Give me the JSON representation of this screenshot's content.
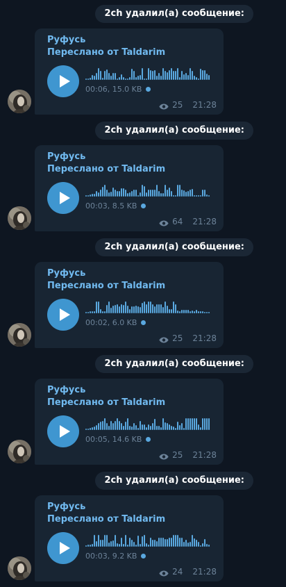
{
  "messages": [
    {
      "service": "2ch удалил(а) сообщение:",
      "sender": "Руфусь",
      "forwarded": "Переслано от Taldarim",
      "duration_size": "00:06, 15.0 KB",
      "views": "25",
      "time": "21:28",
      "waveform": [
        2,
        2,
        3,
        7,
        6,
        10,
        17,
        13,
        3,
        13,
        15,
        10,
        6,
        10,
        10,
        2,
        4,
        8,
        4,
        2,
        2,
        4,
        16,
        13,
        4,
        6,
        7,
        17,
        2,
        2,
        17,
        14,
        13,
        14,
        6,
        10,
        6,
        17,
        13,
        11,
        14,
        17,
        13,
        13,
        17,
        4,
        13,
        8,
        10,
        7,
        17,
        13,
        6,
        4,
        2,
        16,
        14,
        14,
        9,
        7
      ]
    },
    {
      "service": "2ch удалил(а) сообщение:",
      "sender": "Руфусь",
      "forwarded": "Переслано от Taldarim",
      "duration_size": "00:03, 8.5 KB",
      "views": "64",
      "time": "21:28",
      "waveform": [
        2,
        2,
        3,
        4,
        4,
        8,
        6,
        10,
        14,
        17,
        10,
        6,
        7,
        13,
        10,
        8,
        8,
        12,
        12,
        10,
        5,
        6,
        8,
        10,
        10,
        2,
        6,
        17,
        15,
        6,
        10,
        10,
        10,
        10,
        17,
        8,
        5,
        5,
        17,
        10,
        13,
        8,
        2,
        2,
        17,
        17,
        10,
        9,
        7,
        8,
        10,
        11,
        2,
        2,
        2,
        2,
        10,
        10,
        3,
        2
      ]
    },
    {
      "service": "2ch удалил(а) сообщение:",
      "sender": "Руфусь",
      "forwarded": "Переслано от Taldarim",
      "duration_size": "00:02, 6.0 KB",
      "views": "25",
      "time": "21:28",
      "waveform": [
        2,
        2,
        3,
        3,
        3,
        17,
        17,
        6,
        3,
        3,
        12,
        17,
        8,
        11,
        12,
        13,
        10,
        13,
        12,
        17,
        11,
        6,
        10,
        10,
        11,
        10,
        9,
        15,
        17,
        13,
        17,
        17,
        13,
        10,
        13,
        13,
        13,
        9,
        17,
        11,
        6,
        6,
        17,
        13,
        4,
        3,
        5,
        5,
        5,
        5,
        3,
        4,
        3,
        5,
        3,
        3,
        3,
        2,
        2,
        2
      ]
    },
    {
      "service": "2ch удалил(а) сообщение:",
      "sender": "Руфусь",
      "forwarded": "Переслано от Taldarim",
      "duration_size": "00:05, 14.6 KB",
      "views": "25",
      "time": "21:28",
      "waveform": [
        2,
        2,
        3,
        4,
        5,
        7,
        10,
        12,
        13,
        17,
        10,
        6,
        13,
        10,
        13,
        17,
        13,
        10,
        6,
        12,
        17,
        6,
        5,
        10,
        7,
        3,
        13,
        8,
        8,
        4,
        8,
        6,
        10,
        16,
        6,
        6,
        4,
        17,
        11,
        10,
        8,
        6,
        5,
        3,
        12,
        7,
        10,
        3,
        17,
        17,
        17,
        17,
        17,
        17,
        8,
        4,
        17,
        17,
        17,
        17
      ]
    },
    {
      "service": "2ch удалил(а) сообщение:",
      "sender": "Руфусь",
      "forwarded": "Переслано от Taldarim",
      "duration_size": "00:03, 9.2 KB",
      "views": "24",
      "time": "21:28",
      "waveform": [
        2,
        3,
        3,
        4,
        17,
        8,
        17,
        10,
        10,
        17,
        17,
        6,
        8,
        9,
        17,
        5,
        4,
        13,
        4,
        17,
        3,
        13,
        10,
        7,
        3,
        16,
        4,
        15,
        17,
        5,
        3,
        13,
        10,
        10,
        8,
        13,
        13,
        13,
        11,
        11,
        13,
        13,
        17,
        17,
        17,
        13,
        13,
        7,
        10,
        6,
        7,
        17,
        12,
        10,
        7,
        2,
        5,
        11,
        4,
        3
      ]
    }
  ]
}
